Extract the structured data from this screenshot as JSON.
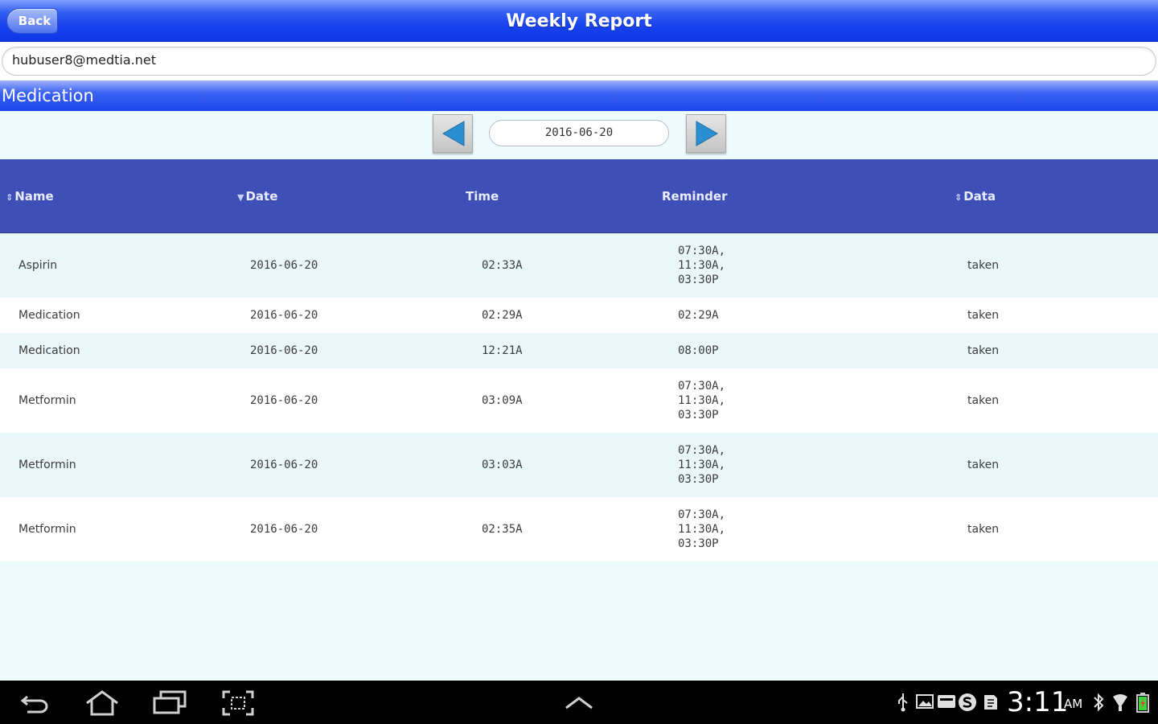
{
  "header": {
    "back_label": "Back",
    "title": "Weekly Report"
  },
  "user": {
    "email": "hubuser8@medtia.net"
  },
  "section": {
    "title": "Medication"
  },
  "date_nav": {
    "current_date": "2016-06-20"
  },
  "table": {
    "columns": [
      {
        "label": "Name",
        "sort_icon": "sort-both-icon"
      },
      {
        "label": "Date",
        "sort_icon": "sort-desc-icon"
      },
      {
        "label": "Time"
      },
      {
        "label": "Reminder"
      },
      {
        "label": "Data",
        "sort_icon": "sort-both-icon"
      }
    ],
    "rows": [
      {
        "name": "Aspirin",
        "date": "2016-06-20",
        "time": "02:33A",
        "reminder": [
          "07:30A,",
          "11:30A,",
          "03:30P"
        ],
        "data": "taken"
      },
      {
        "name": "Medication",
        "date": "2016-06-20",
        "time": "02:29A",
        "reminder": [
          "02:29A"
        ],
        "data": "taken"
      },
      {
        "name": "Medication",
        "date": "2016-06-20",
        "time": "12:21A",
        "reminder": [
          "08:00P"
        ],
        "data": "taken"
      },
      {
        "name": "Metformin",
        "date": "2016-06-20",
        "time": "03:09A",
        "reminder": [
          "07:30A,",
          "11:30A,",
          "03:30P"
        ],
        "data": "taken"
      },
      {
        "name": "Metformin",
        "date": "2016-06-20",
        "time": "03:03A",
        "reminder": [
          "07:30A,",
          "11:30A,",
          "03:30P"
        ],
        "data": "taken"
      },
      {
        "name": "Metformin",
        "date": "2016-06-20",
        "time": "02:35A",
        "reminder": [
          "07:30A,",
          "11:30A,",
          "03:30P"
        ],
        "data": "taken"
      }
    ]
  },
  "system_bar": {
    "time": "3:11",
    "ampm": "AM"
  },
  "colors": {
    "header_blue": "#1a44ef",
    "table_header": "#3f4fb8",
    "row_alt": "#e9f7fb",
    "page_bg": "#eefbfd",
    "nav_arrow": "#2a8fd0"
  }
}
